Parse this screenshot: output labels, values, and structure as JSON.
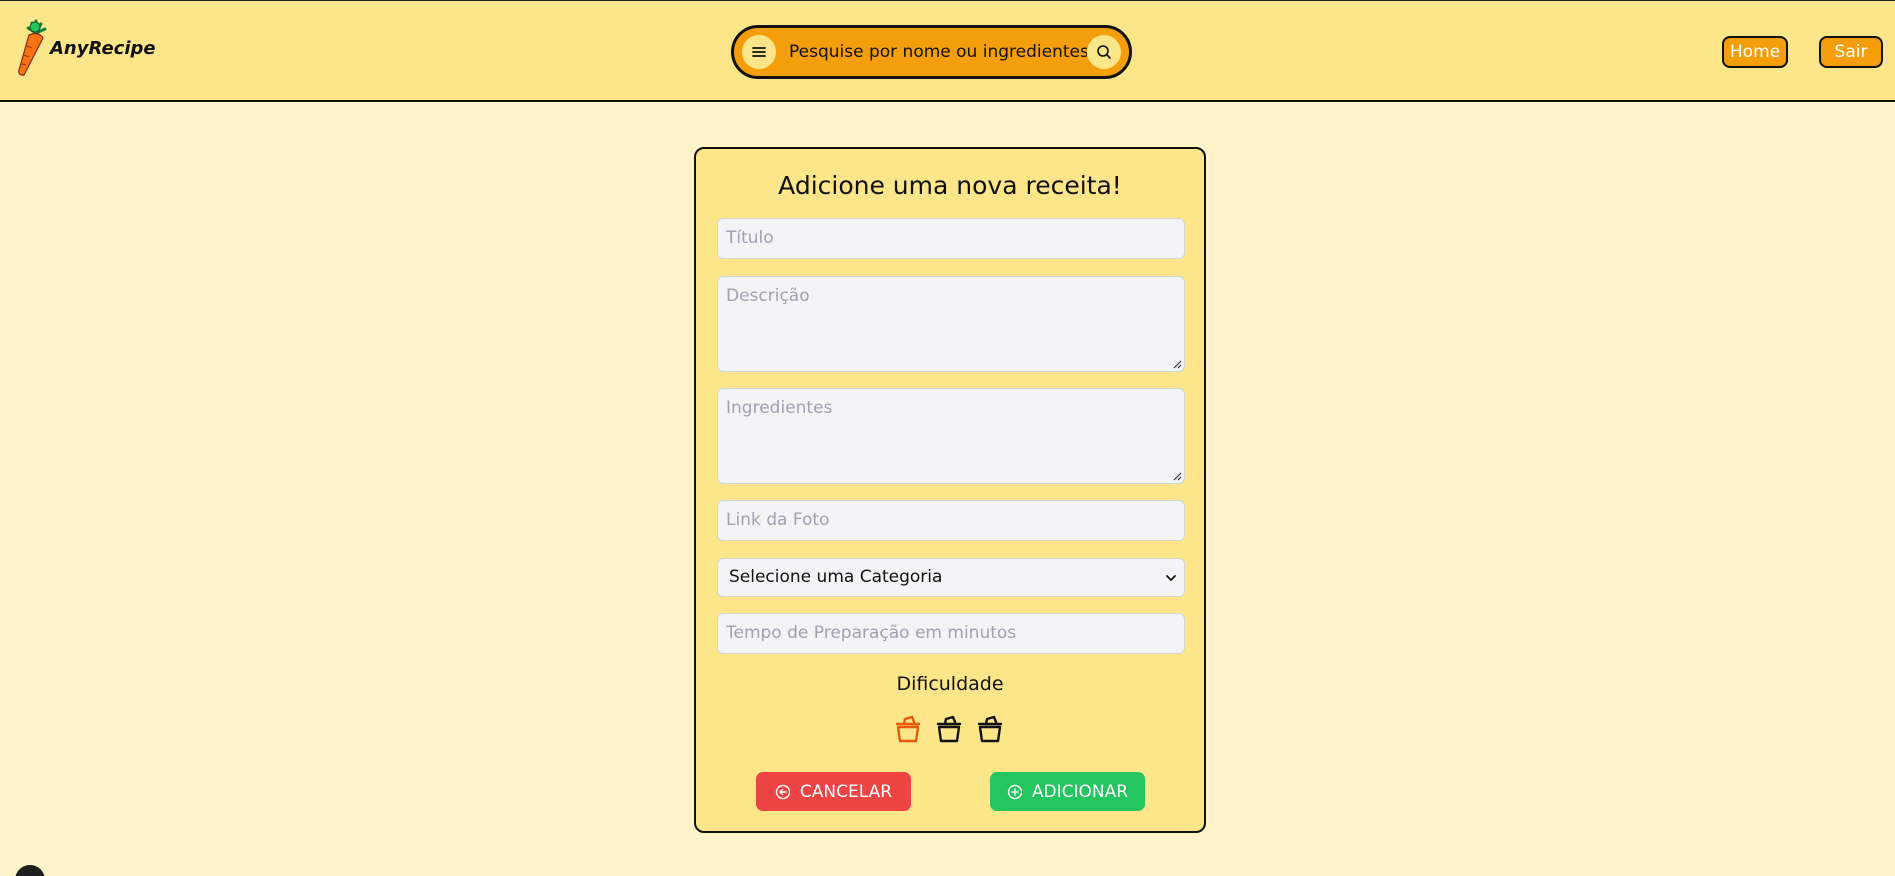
{
  "header": {
    "brand_name": "AnyRecipe",
    "search_placeholder": "Pesquise por nome ou ingredientes",
    "nav_home": "Home",
    "nav_sair": "Sair"
  },
  "form": {
    "title": "Adicione uma nova receita!",
    "titulo_placeholder": "Título",
    "descricao_placeholder": "Descrição",
    "ingredientes_placeholder": "Ingredientes",
    "foto_placeholder": "Link da Foto",
    "categoria_selected": "Selecione uma Categoria",
    "tempo_placeholder": "Tempo de Preparação em minutos",
    "dificuldade_label": "Dificuldade",
    "dificuldade_value": 1,
    "dificuldade_max": 3,
    "cancel_label": "CANCELAR",
    "add_label": "ADICIONAR"
  },
  "icons": {
    "menu": "menu-icon",
    "search": "search-icon",
    "pot": "cooking-pot-icon",
    "cancel": "arrow-left-circle-icon",
    "add": "plus-circle-icon"
  },
  "colors": {
    "header_bg": "#fde68a",
    "page_bg": "#fff4c9",
    "accent": "#f59e0b",
    "cancel": "#ef4444",
    "add": "#22c55e",
    "pot_active": "#ea580c",
    "pot_inactive": "#111111"
  }
}
